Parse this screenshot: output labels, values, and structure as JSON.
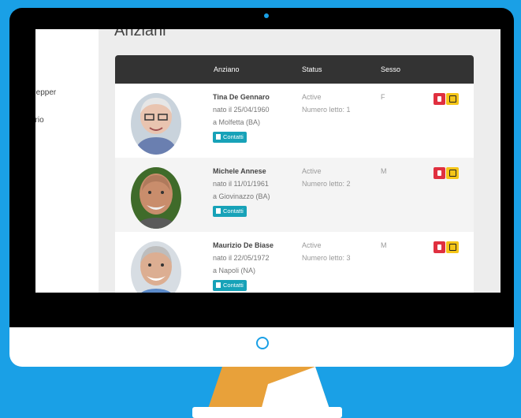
{
  "colors": {
    "background": "#1aa0e6",
    "header": "#333333",
    "contatti": "#17a2b8",
    "delete": "#e0303f",
    "edit": "#f5c518",
    "stand": "#e8a13a"
  },
  "page": {
    "title": "Anziani"
  },
  "sidebar": {
    "items": [
      {
        "label": "e"
      },
      {
        "label": "Pepper"
      },
      {
        "label": "ario"
      }
    ]
  },
  "table": {
    "headers": {
      "anziano": "Anziano",
      "status": "Status",
      "sesso": "Sesso"
    },
    "rows": [
      {
        "name": "Tina De Gennaro",
        "born": "nato il 25/04/1960",
        "place": "a Molfetta (BA)",
        "contatti": "Contatti",
        "status": "Active",
        "letto": "Numero letto: 1",
        "sesso": "F",
        "avatar_icon": "elderly-woman-photo"
      },
      {
        "name": "Michele Annese",
        "born": "nato il 11/01/1961",
        "place": "a Giovinazzo (BA)",
        "contatti": "Contatti",
        "status": "Active",
        "letto": "Numero letto: 2",
        "sesso": "M",
        "avatar_icon": "elderly-man-photo"
      },
      {
        "name": "Maurizio De Biase",
        "born": "nato il 22/05/1972",
        "place": "a Napoli (NA)",
        "contatti": "Contatti",
        "status": "Active",
        "letto": "Numero letto: 3",
        "sesso": "M",
        "avatar_icon": "elderly-man-photo"
      }
    ]
  }
}
